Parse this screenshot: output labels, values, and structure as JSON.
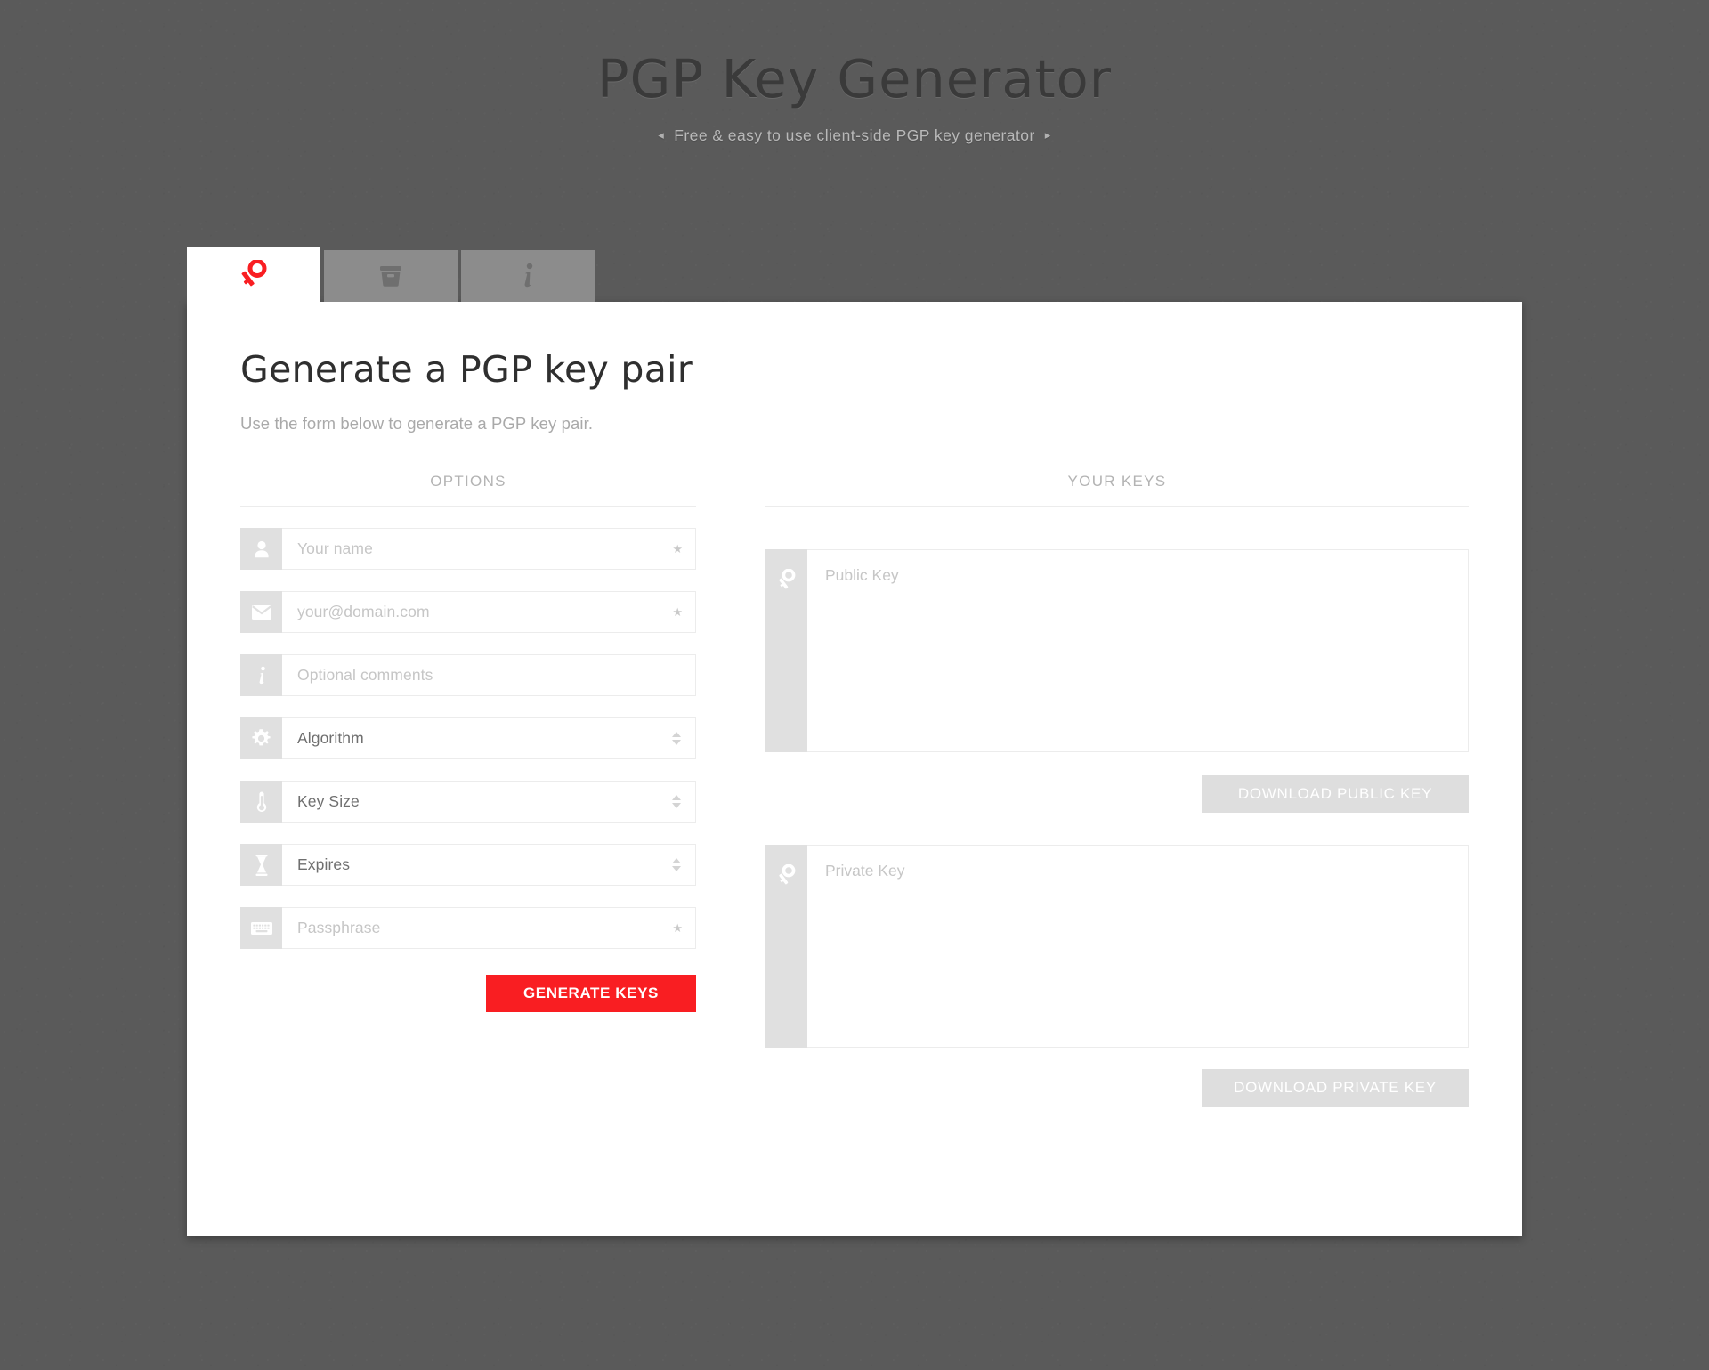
{
  "header": {
    "title": "PGP Key Generator",
    "subtitle": "Free & easy to use client-side PGP key generator",
    "arrow_left": "◂",
    "arrow_right": "▸"
  },
  "tabs": [
    {
      "icon": "key-icon",
      "active": true
    },
    {
      "icon": "archive-icon",
      "active": false
    },
    {
      "icon": "info-icon",
      "active": false
    }
  ],
  "main": {
    "page_title": "Generate a PGP key pair",
    "page_desc": "Use the form below to generate a PGP key pair.",
    "options_heading": "OPTIONS",
    "keys_heading": "YOUR KEYS"
  },
  "form": {
    "required_marker": "★",
    "fields": [
      {
        "icon": "person-icon",
        "text": "Your name",
        "kind": "placeholder",
        "required": true,
        "control": "none"
      },
      {
        "icon": "envelope-icon",
        "text": "your@domain.com",
        "kind": "placeholder",
        "required": true,
        "control": "none"
      },
      {
        "icon": "info-icon",
        "text": "Optional comments",
        "kind": "placeholder",
        "required": false,
        "control": "none"
      },
      {
        "icon": "gear-icon",
        "text": "Algorithm",
        "kind": "value",
        "required": false,
        "control": "spinner"
      },
      {
        "icon": "thermometer-icon",
        "text": "Key Size",
        "kind": "value",
        "required": false,
        "control": "spinner"
      },
      {
        "icon": "hourglass-icon",
        "text": "Expires",
        "kind": "value",
        "required": false,
        "control": "spinner"
      },
      {
        "icon": "keyboard-icon",
        "text": "Passphrase",
        "kind": "placeholder",
        "required": true,
        "control": "none"
      }
    ],
    "generate_label": "GENERATE KEYS"
  },
  "keys": {
    "public": {
      "icon": "key-icon",
      "placeholder": "Public Key",
      "value": "",
      "download_label": "DOWNLOAD PUBLIC KEY",
      "download_disabled": true
    },
    "private": {
      "icon": "key-icon",
      "placeholder": "Private Key",
      "value": "",
      "download_label": "DOWNLOAD PRIVATE KEY",
      "download_disabled": true
    }
  },
  "colors": {
    "background": "#5a5a5a",
    "card": "#ffffff",
    "accent_red": "#f91e22",
    "tab_inactive": "#8c8c8c",
    "icon_cell": "#e0e0e0",
    "disabled_button": "#dedede",
    "placeholder_text": "#c6c6c6"
  }
}
